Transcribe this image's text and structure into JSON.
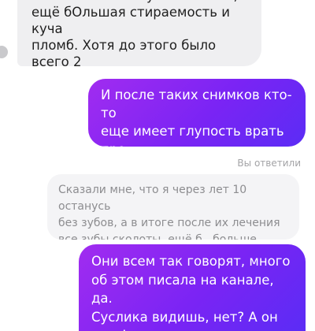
{
  "messages": [
    {
      "direction": "incoming",
      "text": "их лечения все зубы сколоты,\nещё бОльшая стираемость и куча\nпломб. Хотя до этого было всего 2\nпломбы во рту"
    },
    {
      "direction": "outgoing",
      "text": "И после таких снимков кто-то\nеще имеет глупость врать про\nнеподвижные кости черепа..."
    },
    {
      "direction": "outgoing",
      "text": "Они всем так говорят, много\nоб этом писала на канале, да.\nСуслика видишь, нет? А он есть!\nИли обязательно будет, лет через"
    }
  ],
  "reply": {
    "label": "Вы ответили",
    "quoted_text": "Сказали мне, что я через лет 10 останусь\nбез зубов, а в итоге после их лечения\nвсе зубы сколоты,  ещё б...больше"
  },
  "colors": {
    "incoming_bubble": "#efeff1",
    "outgoing_gradient_start": "#a12cf0",
    "outgoing_gradient_end": "#5b2cf5",
    "quote_bubble": "#f4f4f6",
    "muted_text": "#a3a3a6"
  }
}
